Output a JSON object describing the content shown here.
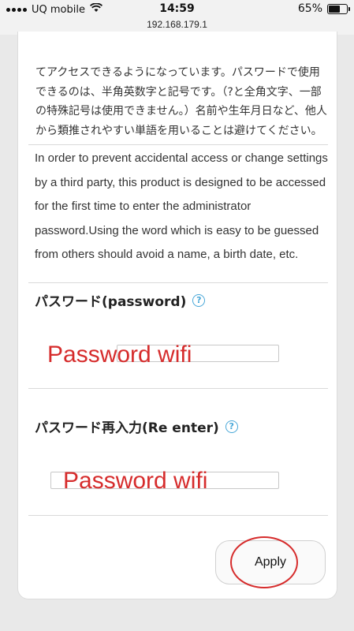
{
  "status_bar": {
    "carrier": "UQ mobile",
    "time": "14:59",
    "battery_percent_label": "65%",
    "battery_level": 0.65
  },
  "browser": {
    "url": "192.168.179.1"
  },
  "description": {
    "japanese": "てアクセスできるようになっています。パスワードで使用できるのは、半角英数字と記号です。（?と全角文字、一部の特殊記号は使用できません。）名前や生年月日など、他人から類推されやすい単語を用いることは避けてください。",
    "english": "In order to prevent accidental access or change settings by a third party, this product is designed to be accessed for the first time to enter the administrator password.Using the word which is easy to be guessed from others should avoid a name, a birth date, etc."
  },
  "password_field": {
    "label": "パスワード(password)",
    "help": "?",
    "overlay_text": "Password wifi"
  },
  "reenter_field": {
    "label": "パスワード再入力(Re enter)",
    "help": "?",
    "overlay_text": "Password wifi"
  },
  "apply_button": {
    "label": "Apply"
  },
  "colors": {
    "accent": "#48a7d8",
    "annotation": "#d62c2c"
  }
}
